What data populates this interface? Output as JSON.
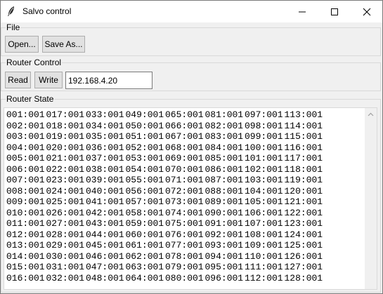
{
  "window": {
    "title": "Salvo control"
  },
  "file_group": {
    "legend": "File",
    "open_label": "Open...",
    "save_as_label": "Save As..."
  },
  "router_group": {
    "legend": "Router Control",
    "read_label": "Read",
    "write_label": "Write",
    "ip_value": "192.168.4.20"
  },
  "state_group": {
    "legend": "Router State",
    "rows": [
      [
        "001:001",
        "017:001",
        "033:001",
        "049:001",
        "065:001",
        "081:001",
        "097:001",
        "113:001"
      ],
      [
        "002:001",
        "018:001",
        "034:001",
        "050:001",
        "066:001",
        "082:001",
        "098:001",
        "114:001"
      ],
      [
        "003:001",
        "019:001",
        "035:001",
        "051:001",
        "067:001",
        "083:001",
        "099:001",
        "115:001"
      ],
      [
        "004:001",
        "020:001",
        "036:001",
        "052:001",
        "068:001",
        "084:001",
        "100:001",
        "116:001"
      ],
      [
        "005:001",
        "021:001",
        "037:001",
        "053:001",
        "069:001",
        "085:001",
        "101:001",
        "117:001"
      ],
      [
        "006:001",
        "022:001",
        "038:001",
        "054:001",
        "070:001",
        "086:001",
        "102:001",
        "118:001"
      ],
      [
        "007:001",
        "023:001",
        "039:001",
        "055:001",
        "071:001",
        "087:001",
        "103:001",
        "119:001"
      ],
      [
        "008:001",
        "024:001",
        "040:001",
        "056:001",
        "072:001",
        "088:001",
        "104:001",
        "120:001"
      ],
      [
        "009:001",
        "025:001",
        "041:001",
        "057:001",
        "073:001",
        "089:001",
        "105:001",
        "121:001"
      ],
      [
        "010:001",
        "026:001",
        "042:001",
        "058:001",
        "074:001",
        "090:001",
        "106:001",
        "122:001"
      ],
      [
        "011:001",
        "027:001",
        "043:001",
        "059:001",
        "075:001",
        "091:001",
        "107:001",
        "123:001"
      ],
      [
        "012:001",
        "028:001",
        "044:001",
        "060:001",
        "076:001",
        "092:001",
        "108:001",
        "124:001"
      ],
      [
        "013:001",
        "029:001",
        "045:001",
        "061:001",
        "077:001",
        "093:001",
        "109:001",
        "125:001"
      ],
      [
        "014:001",
        "030:001",
        "046:001",
        "062:001",
        "078:001",
        "094:001",
        "110:001",
        "126:001"
      ],
      [
        "015:001",
        "031:001",
        "047:001",
        "063:001",
        "079:001",
        "095:001",
        "111:001",
        "127:001"
      ],
      [
        "016:001",
        "032:001",
        "048:001",
        "064:001",
        "080:001",
        "096:001",
        "112:001",
        "128:001"
      ]
    ]
  }
}
